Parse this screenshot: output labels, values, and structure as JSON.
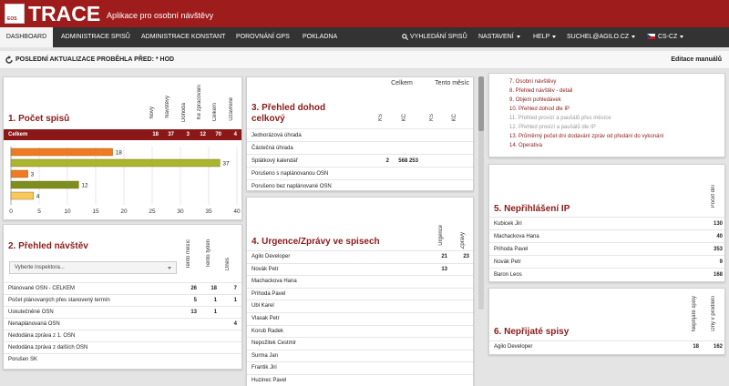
{
  "header": {
    "logo_text": "EOS",
    "brand": "TRACE",
    "tagline": "Aplikace pro osobní návštěvy"
  },
  "nav": {
    "items": [
      {
        "label": "Dashboard"
      },
      {
        "label": "Administrace spisů"
      },
      {
        "label": "Administrace konstant"
      },
      {
        "label": "Porovnání GPS"
      },
      {
        "label": "Pokladna"
      }
    ],
    "search_label": "Vyhledání spisů",
    "settings_label": "Nastavení",
    "help_label": "Help",
    "user_label": "suchel@agilo.cz",
    "lang_label": "CS-CZ"
  },
  "status": {
    "last_update": "Poslední aktualizace proběhla před: * hod",
    "edit_manuals": "Editace manuálů"
  },
  "panel1": {
    "title": "1. Počet spisů",
    "columns": [
      "Nový",
      "Návštěvy",
      "Dohoda",
      "Ke zpracování",
      "Celkem",
      "Uzavřené"
    ],
    "total_label": "Celkem",
    "total_values": [
      "18",
      "37",
      "3",
      "12",
      "70",
      "4"
    ],
    "chart_data": {
      "type": "bar",
      "orientation": "horizontal",
      "categories": [
        "Nový",
        "Návštěvy",
        "Dohoda",
        "Ke zpracování",
        "Uzavřené"
      ],
      "values": [
        18,
        37,
        3,
        12,
        4
      ],
      "data_labels": [
        "18",
        "37",
        "3",
        "12",
        "4"
      ],
      "colors": [
        "#f07a21",
        "#a9b62e",
        "#f07a21",
        "#7b8f1e",
        "#f7c85a"
      ],
      "xlim": [
        0,
        40
      ],
      "x_ticks": [
        "0",
        "5",
        "10",
        "15",
        "20",
        "25",
        "30",
        "35",
        "40"
      ],
      "grid": true
    }
  },
  "panel2": {
    "title": "2. Přehled návštěv",
    "dropdown_placeholder": "Vyberte inspektora...",
    "columns": [
      "Tento měsíc",
      "Tento týden",
      "Dnes"
    ],
    "rows": [
      {
        "label": "Plánované OSN - CELKEM",
        "values": [
          "26",
          "18",
          "7"
        ]
      },
      {
        "label": "Počet plánovaných přes stanovený termín",
        "values": [
          "5",
          "1",
          "1"
        ]
      },
      {
        "label": "Uskutečněné OSN",
        "values": [
          "13",
          "1",
          ""
        ]
      },
      {
        "label": "Nenaplánovaná OSN",
        "values": [
          "",
          "",
          "4"
        ]
      },
      {
        "label": "Nedodána zpráva z 1. OSN",
        "values": [
          "",
          "",
          ""
        ]
      },
      {
        "label": "Nedodána zpráva z dalších OSN",
        "values": [
          "",
          "",
          ""
        ]
      },
      {
        "label": "Porušen SK",
        "values": [
          "",
          "",
          ""
        ]
      }
    ]
  },
  "panel3": {
    "title_line1": "3. Přehled dohod",
    "title_line2": "celkový",
    "group_headers": [
      "Celkem",
      "Tento měsíc"
    ],
    "columns": [
      "KS",
      "KČ",
      "KS",
      "KČ"
    ],
    "rows": [
      {
        "label": "Jednorázová úhrada",
        "values": [
          "",
          "",
          "",
          ""
        ]
      },
      {
        "label": "Částečná úhrada",
        "values": [
          "",
          "",
          "",
          ""
        ]
      },
      {
        "label": "Splátkový kalendář",
        "values": [
          "2",
          "568 253",
          "",
          ""
        ]
      },
      {
        "label": "Porušeno s naplánovanou OSN",
        "values": [
          "",
          "",
          "",
          ""
        ]
      },
      {
        "label": "Porušeno bez naplánované OSN",
        "values": [
          "",
          "",
          "",
          ""
        ]
      }
    ]
  },
  "panel4": {
    "title": "4. Urgence/Zprávy ve spisech",
    "columns": [
      "Urgence",
      "Zprávy"
    ],
    "rows": [
      {
        "label": "Agilo Developer",
        "values": [
          "21",
          "23"
        ]
      },
      {
        "label": "Novák Petr",
        "values": [
          "13",
          ""
        ]
      },
      {
        "label": "Machackova Hana",
        "values": [
          "",
          ""
        ]
      },
      {
        "label": "Prihoda Pavel",
        "values": [
          "",
          ""
        ]
      },
      {
        "label": "Ubl Karel",
        "values": [
          "",
          ""
        ]
      },
      {
        "label": "Vlasak Petr",
        "values": [
          "",
          ""
        ]
      },
      {
        "label": "Korub Radek",
        "values": [
          "",
          ""
        ]
      },
      {
        "label": "Nepožitek Cestmir",
        "values": [
          "",
          ""
        ]
      },
      {
        "label": "Surma Jan",
        "values": [
          "",
          ""
        ]
      },
      {
        "label": "Frantik Jiri",
        "values": [
          "",
          ""
        ]
      },
      {
        "label": "Huzinec Pavel",
        "values": [
          "",
          ""
        ]
      }
    ]
  },
  "reports": {
    "items": [
      {
        "label": "7. Osobní návštěvy",
        "muted": false
      },
      {
        "label": "8. Přehled návštěv - detail",
        "muted": false
      },
      {
        "label": "9. Objem pohledávek",
        "muted": false
      },
      {
        "label": "10. Přehled dohod dle IP",
        "muted": false
      },
      {
        "label": "11. Přehled provizí a paušálů přes měsíce",
        "muted": true
      },
      {
        "label": "12. Přehled provizí a paušálů dle IP",
        "muted": true
      },
      {
        "label": "13. Průměrný počet dní dodávání zpráv od předání do vykonání",
        "muted": false
      },
      {
        "label": "14. Operativa",
        "muted": false
      }
    ]
  },
  "panel5": {
    "title": "5. Nepřihlášení IP",
    "column": "Počet dní",
    "rows": [
      {
        "label": "Kubicek Jiri",
        "value": "130"
      },
      {
        "label": "Machackova Hana",
        "value": "40"
      },
      {
        "label": "Prihoda Pavel",
        "value": "353"
      },
      {
        "label": "Novák Petr",
        "value": "9"
      },
      {
        "label": "Baron Leos",
        "value": "168"
      }
    ]
  },
  "panel6": {
    "title": "6. Nepřijaté spisy",
    "columns": [
      "Nepřijaté spisy",
      "Dny v prodlení"
    ],
    "rows": [
      {
        "label": "Agilo Developer",
        "values": [
          "18",
          "162"
        ]
      }
    ]
  }
}
